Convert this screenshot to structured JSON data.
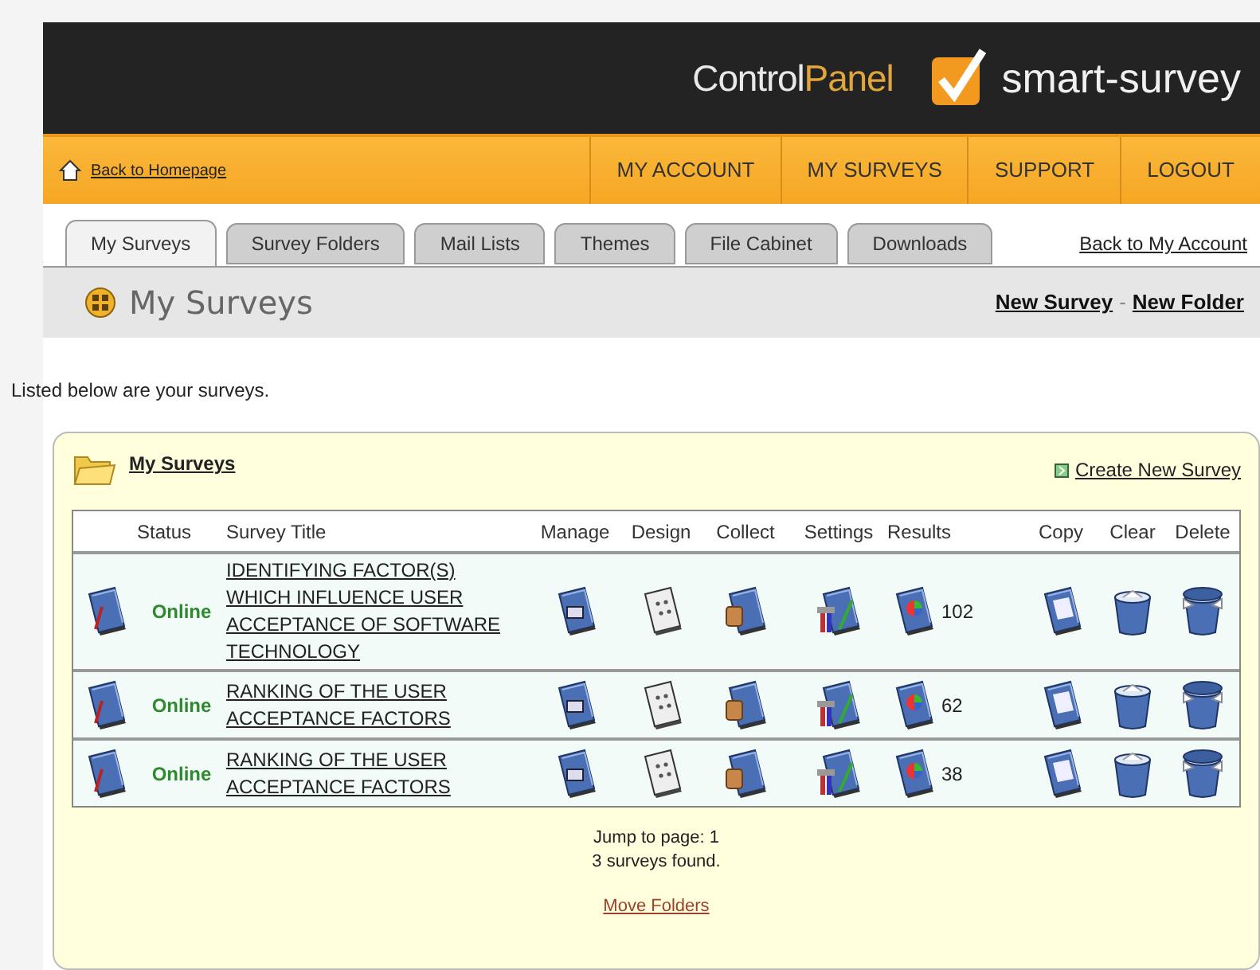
{
  "header": {
    "product": "Control",
    "product_accent": "Panel",
    "brand": "smart-survey"
  },
  "nav": {
    "home_link": "Back to Homepage",
    "items": [
      "MY ACCOUNT",
      "MY SURVEYS",
      "SUPPORT",
      "LOGOUT"
    ]
  },
  "tabs": [
    {
      "label": "My Surveys",
      "selected": true
    },
    {
      "label": "Survey Folders",
      "selected": false
    },
    {
      "label": "Mail Lists",
      "selected": false
    },
    {
      "label": "Themes",
      "selected": false
    },
    {
      "label": "File Cabinet",
      "selected": false
    },
    {
      "label": "Downloads",
      "selected": false
    }
  ],
  "account_link": "Back to My Account",
  "page_title": "My Surveys",
  "page_links": [
    "New Survey",
    "New Folder"
  ],
  "page_links_separator": "-",
  "intro": "Listed below are your surveys.",
  "panel": {
    "title": "My Surveys",
    "create_link": "Create New Survey",
    "columns": [
      "Status",
      "Survey Title",
      "Manage",
      "Design",
      "Collect",
      "Settings",
      "Results",
      "Copy",
      "Clear",
      "Delete"
    ],
    "rows": [
      {
        "status": "Online",
        "title": "IDENTIFYING FACTOR(S) WHICH INFLUENCE USER ACCEPTANCE OF SOFTWARE TECHNOLOGY",
        "responses": "102"
      },
      {
        "status": "Online",
        "title": "RANKING OF THE USER ACCEPTANCE FACTORS",
        "responses": "62"
      },
      {
        "status": "Online",
        "title": "RANKING OF THE USER ACCEPTANCE FACTORS",
        "responses": "38"
      }
    ],
    "jump": "Jump to page: 1",
    "found": "3 surveys found.",
    "move_link": "Move Folders"
  }
}
